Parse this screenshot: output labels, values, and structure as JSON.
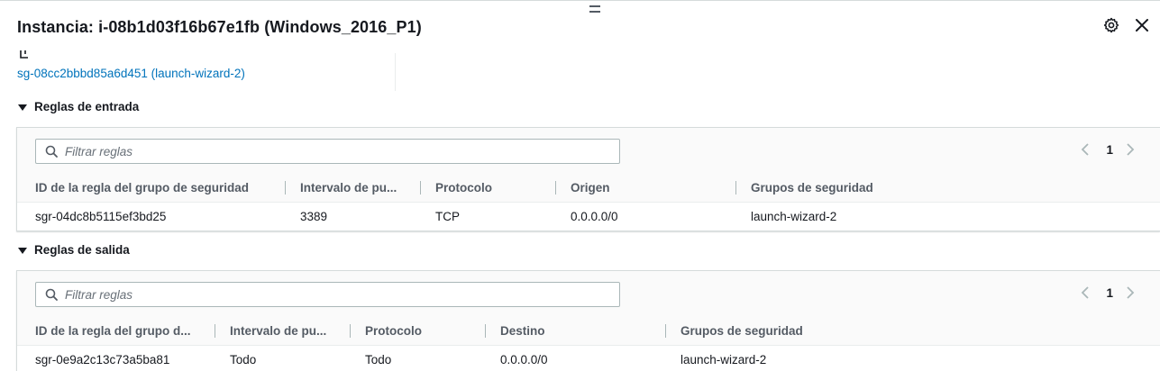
{
  "header": {
    "title": "Instancia: i-08b1d03f16b67e1fb (Windows_2016_P1)"
  },
  "security_group": {
    "link": "sg-08cc2bbbd85a6d451 (launch-wizard-2)"
  },
  "inbound": {
    "section_label": "Reglas de entrada",
    "filter_placeholder": "Filtrar reglas",
    "page": "1",
    "columns": [
      "ID de la regla del grupo de seguridad",
      "Intervalo de pu...",
      "Protocolo",
      "Origen",
      "Grupos de seguridad"
    ],
    "rows": [
      [
        "sgr-04dc8b5115ef3bd25",
        "3389",
        "TCP",
        "0.0.0.0/0",
        "launch-wizard-2"
      ]
    ]
  },
  "outbound": {
    "section_label": "Reglas de salida",
    "filter_placeholder": "Filtrar reglas",
    "page": "1",
    "columns": [
      "ID de la regla del grupo d...",
      "Intervalo de pu...",
      "Protocolo",
      "Destino",
      "Grupos de seguridad"
    ],
    "rows": [
      [
        "sgr-0e9a2c13c73a5ba81",
        "Todo",
        "Todo",
        "0.0.0.0/0",
        "launch-wizard-2"
      ]
    ]
  },
  "icons": {
    "settings": "gear-icon",
    "close": "close-icon",
    "copy": "copy-icon",
    "search": "search-icon",
    "expand": "caret-down-icon",
    "prev": "chevron-left-icon",
    "next": "chevron-right-icon"
  },
  "colors": {
    "link": "#0073bb",
    "header_text": "#545b64",
    "border": "#d5dbdb"
  }
}
